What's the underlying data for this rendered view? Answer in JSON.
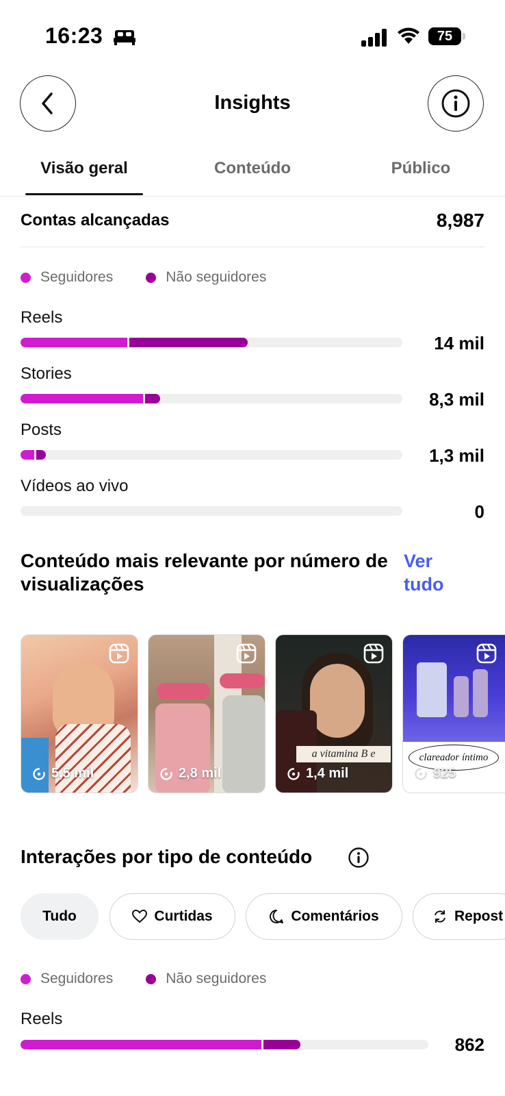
{
  "status": {
    "time": "16:23",
    "battery": "75"
  },
  "header": {
    "title": "Insights"
  },
  "tabs": [
    {
      "label": "Visão geral",
      "active": true
    },
    {
      "label": "Conteúdo",
      "active": false
    },
    {
      "label": "Público",
      "active": false
    }
  ],
  "reached": {
    "label": "Contas alcançadas",
    "value": "8,987"
  },
  "legend": {
    "followers": "Seguidores",
    "non_followers": "Não seguidores"
  },
  "colors": {
    "followers": "#d11bd1",
    "non_followers": "#990099",
    "link": "#4a5cf0"
  },
  "reach_breakdown": [
    {
      "label": "Reels",
      "value": "14 mil",
      "followers_fraction": 0.28,
      "non_followers_fraction": 0.31
    },
    {
      "label": "Stories",
      "value": "8,3 mil",
      "followers_fraction": 0.32,
      "non_followers_fraction": 0.04
    },
    {
      "label": "Posts",
      "value": "1,3 mil",
      "followers_fraction": 0.035,
      "non_followers_fraction": 0.025
    },
    {
      "label": "Vídeos ao vivo",
      "value": "0",
      "followers_fraction": 0,
      "non_followers_fraction": 0
    }
  ],
  "top_content": {
    "title": "Conteúdo mais relevante por número de visualizações",
    "see_all": "Ver tudo",
    "items": [
      {
        "views": "5,5 mil",
        "caption": ""
      },
      {
        "views": "2,8 mil",
        "caption": ""
      },
      {
        "views": "1,4 mil",
        "caption": "a vitamina B e"
      },
      {
        "views": "925",
        "caption": "clareador íntimo"
      }
    ]
  },
  "interactions": {
    "title": "Interações por tipo de conteúdo",
    "chips": [
      {
        "label": "Tudo",
        "icon": "",
        "selected": true
      },
      {
        "label": "Curtidas",
        "icon": "heart-icon",
        "selected": false
      },
      {
        "label": "Comentários",
        "icon": "comment-icon",
        "selected": false
      },
      {
        "label": "Repost",
        "icon": "repost-icon",
        "selected": false
      }
    ],
    "breakdown": [
      {
        "label": "Reels",
        "value": "862",
        "followers_fraction": 0.59,
        "non_followers_fraction": 0.09
      }
    ]
  }
}
